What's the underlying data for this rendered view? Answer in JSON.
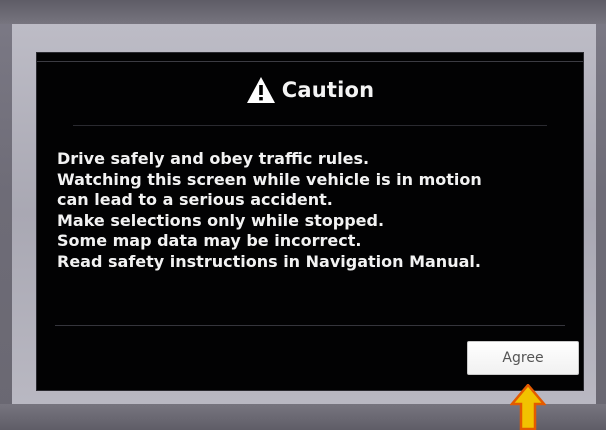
{
  "dialog": {
    "title": "Caution",
    "icon": "warning-icon",
    "lines": [
      "Drive safely and obey traffic rules.",
      "Watching this screen while vehicle is in motion",
      "can lead to a serious accident.",
      "Make selections only while stopped.",
      "Some map data may be incorrect.",
      "Read safety instructions in Navigation Manual."
    ],
    "agree_label": "Agree"
  },
  "annotation": {
    "icon": "up-arrow-icon",
    "color": "#f2c200",
    "outline": "#e35a00"
  },
  "colors": {
    "screen_bg": "#020203",
    "text": "#f2f2f2",
    "bezel": "#6f6d78"
  }
}
